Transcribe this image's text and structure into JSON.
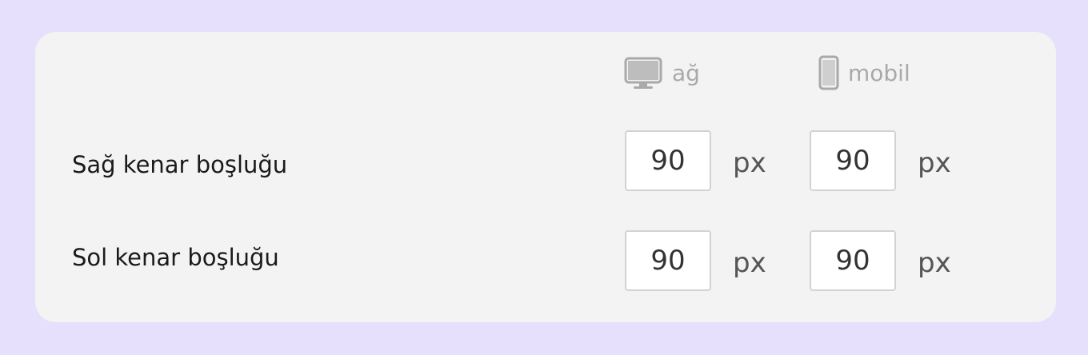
{
  "columns": {
    "desktop": {
      "label": "ağ",
      "icon": "desktop-monitor-icon"
    },
    "mobile": {
      "label": "mobil",
      "icon": "mobile-phone-icon"
    }
  },
  "rows": [
    {
      "label": "Sağ kenar boşluğu",
      "desktop_value": "90",
      "mobile_value": "90",
      "unit": "px"
    },
    {
      "label": "Sol kenar boşluğu",
      "desktop_value": "90",
      "mobile_value": "90",
      "unit": "px"
    }
  ],
  "colors": {
    "background": "#e6e0fc",
    "panel": "#f3f3f3",
    "header_text": "#a9a9a9",
    "label_text": "#1a1a1a",
    "input_border": "#d2d2d2"
  }
}
